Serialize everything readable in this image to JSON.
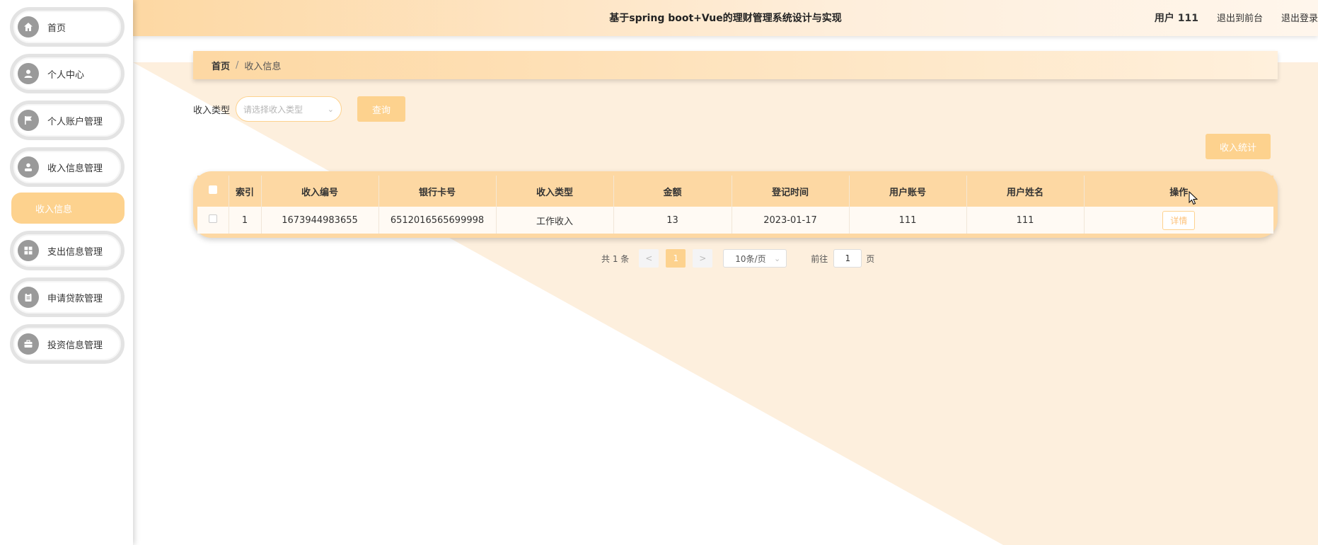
{
  "header": {
    "title": "基于spring boot+Vue的理财管理系统设计与实现",
    "user": "用户 111",
    "back_front": "退出到前台",
    "logout": "退出登录"
  },
  "sidebar": {
    "items": [
      {
        "label": "首页",
        "icon": "home-icon"
      },
      {
        "label": "个人中心",
        "icon": "user-icon"
      },
      {
        "label": "个人账户管理",
        "icon": "flag-icon"
      },
      {
        "label": "收入信息管理",
        "icon": "person-icon"
      },
      {
        "label": "支出信息管理",
        "icon": "grid-icon"
      },
      {
        "label": "申请贷款管理",
        "icon": "clipboard-icon"
      },
      {
        "label": "投资信息管理",
        "icon": "briefcase-icon"
      }
    ],
    "active_sub": "收入信息"
  },
  "breadcrumb": {
    "home": "首页",
    "sep": "/",
    "current": "收入信息"
  },
  "search": {
    "label": "收入类型",
    "placeholder": "请选择收入类型",
    "query_button": "查询",
    "stat_button": "收入统计"
  },
  "table": {
    "headers": [
      "索引",
      "收入编号",
      "银行卡号",
      "收入类型",
      "金额",
      "登记时间",
      "用户账号",
      "用户姓名",
      "操作"
    ],
    "rows": [
      {
        "index": "1",
        "income_no": "1673944983655",
        "card_no": "6512016565699998",
        "type": "工作收入",
        "amount": "13",
        "date": "2023-01-17",
        "account": "111",
        "name": "111",
        "action": "详情"
      }
    ]
  },
  "pager": {
    "total": "共 1 条",
    "prev": "<",
    "page": "1",
    "next": ">",
    "size": "10条/页",
    "goto_label": "前往",
    "goto_value": "1",
    "page_unit": "页"
  },
  "colors": {
    "accent": "#fdd28e",
    "header_bg": "#fdd8a3",
    "diag_bg": "#fdefdd"
  }
}
